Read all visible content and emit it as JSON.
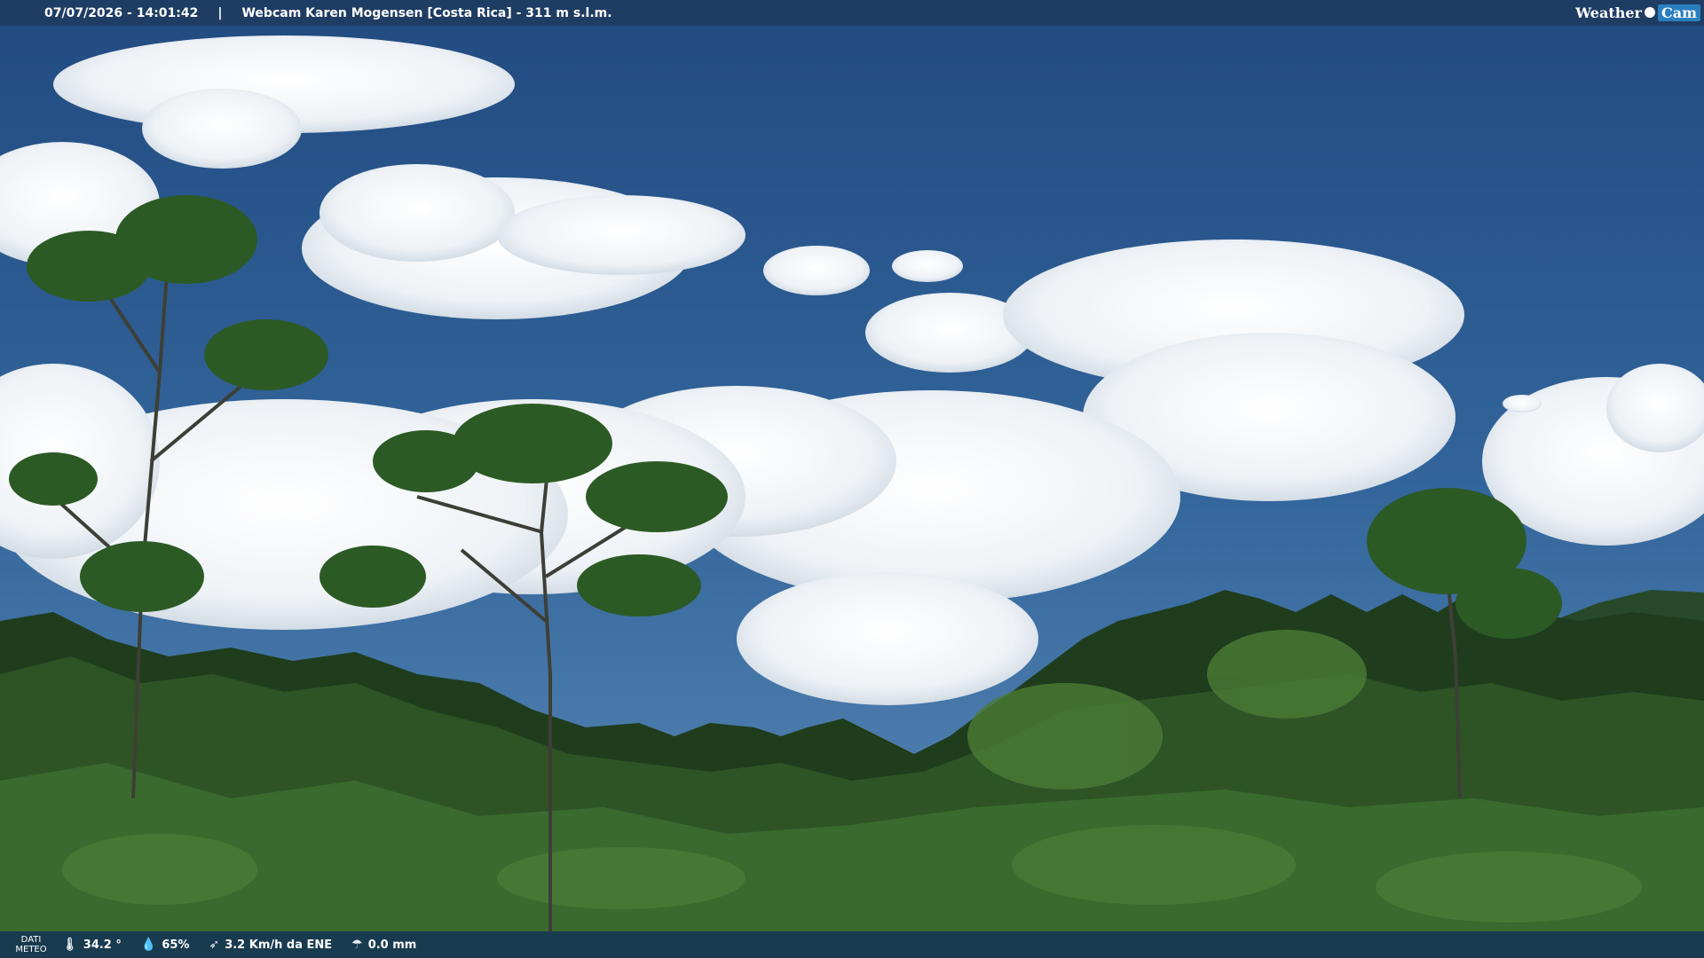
{
  "header": {
    "datetime": "07/07/2026 - 14:01:42",
    "separator": "|",
    "title": "Webcam Karen Mogensen [Costa Rica]  - 311 m s.l.m."
  },
  "logo": {
    "left": "Weather",
    "right": "Cam"
  },
  "footer": {
    "label_line1": "DATI",
    "label_line2": "METEO",
    "temperature": "34.2 °",
    "humidity": "65%",
    "wind": "3.2 Km/h da ENE",
    "rain": "0.0 mm"
  },
  "icons": {
    "temperature": "thermometer-icon",
    "humidity": "humidity-icon",
    "wind": "wind-icon",
    "rain": "rain-icon"
  },
  "colors": {
    "sky_top": "#254f86",
    "sky_bottom": "#4f7fae",
    "cloud": "#f2f5f8",
    "forest_dark": "#1d3a1b",
    "forest_mid": "#2f5526",
    "forest_light": "#4b7a36",
    "bar": "#1f3d63"
  }
}
